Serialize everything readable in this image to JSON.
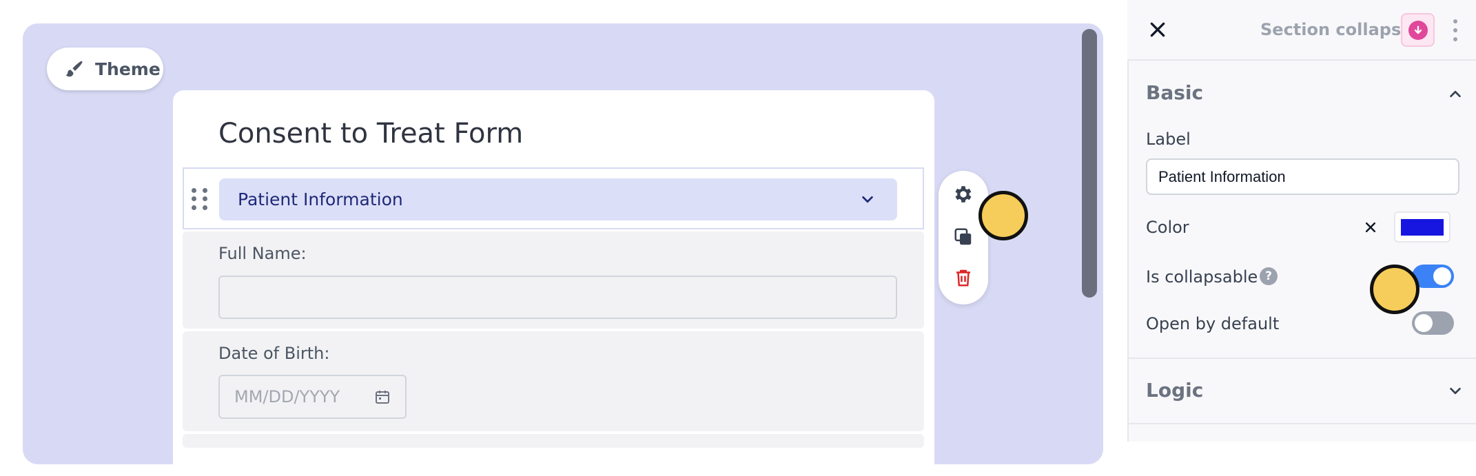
{
  "canvas": {
    "theme_button_label": "Theme"
  },
  "form": {
    "title": "Consent to Treat Form",
    "section": {
      "label": "Patient Information"
    },
    "fields": [
      {
        "label": "Full Name:",
        "value": ""
      },
      {
        "label": "Date of Birth:",
        "placeholder": "MM/DD/YYYY",
        "value": ""
      }
    ]
  },
  "actions": {
    "icons": [
      "gear-icon",
      "copy-icon",
      "trash-icon"
    ],
    "trash_color": "#dc2626"
  },
  "panel": {
    "title": "Section collapse",
    "badge_color": "#e0489a",
    "basic": {
      "title": "Basic",
      "label_caption": "Label",
      "label_value": "Patient Information",
      "color_caption": "Color",
      "color_value": "#1616e0",
      "collapsable_caption": "Is collapsable",
      "collapsable_on": true,
      "open_default_caption": "Open by default",
      "open_default_on": false
    },
    "logic": {
      "title": "Logic"
    }
  }
}
